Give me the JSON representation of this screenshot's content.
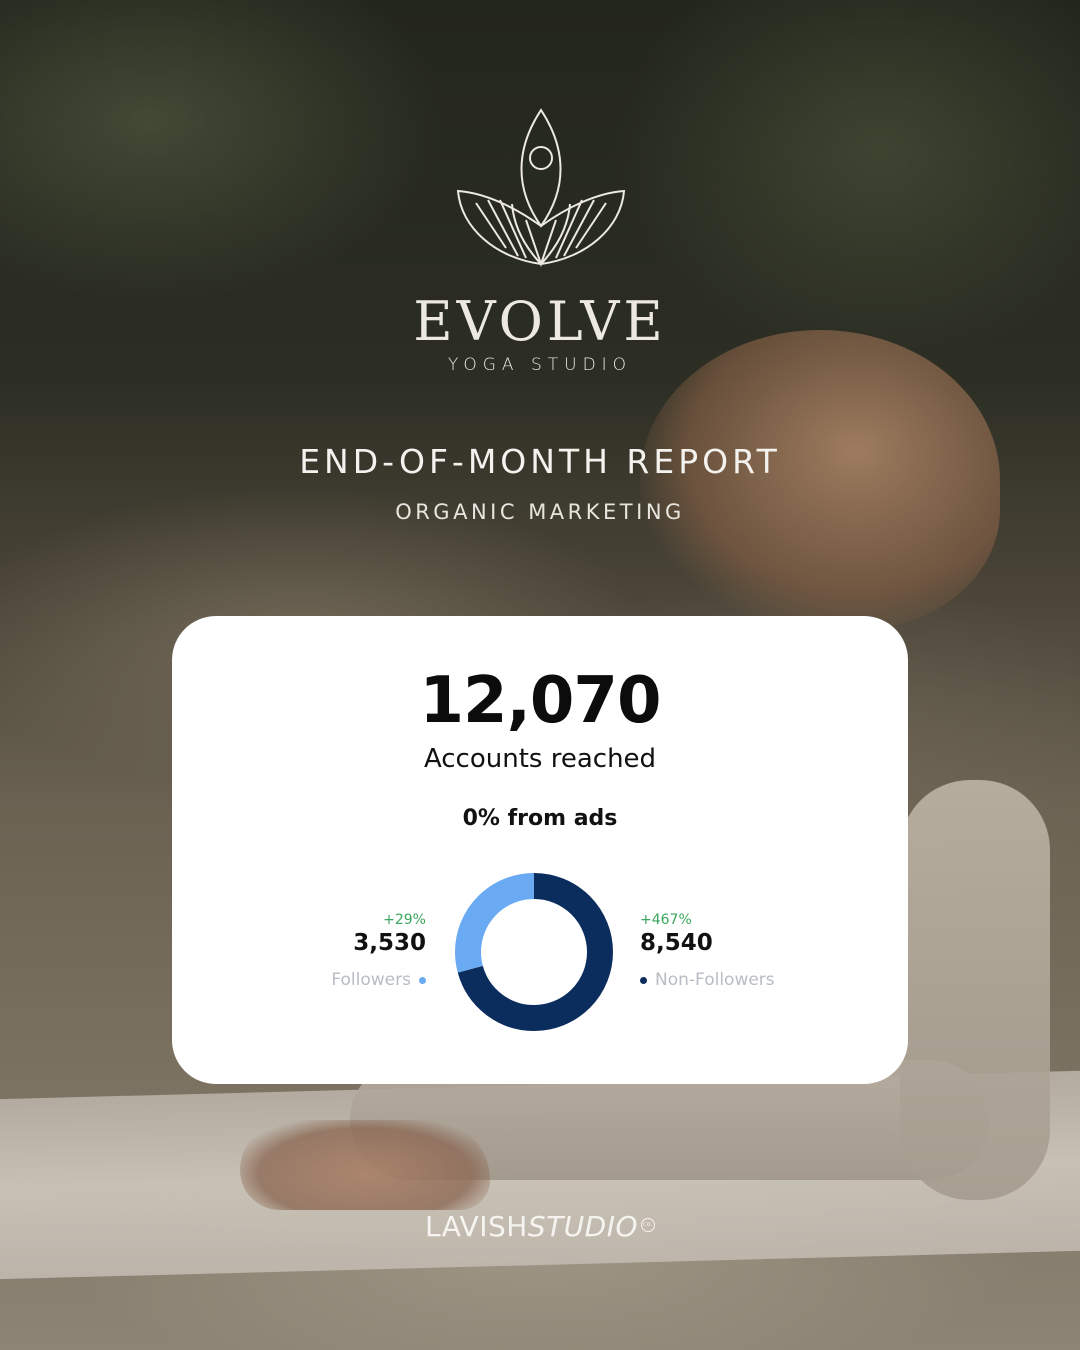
{
  "brand": {
    "name": "EVOLVE",
    "subtitle": "YOGA STUDIO",
    "logo_icon": "lotus-icon"
  },
  "report": {
    "title": "END-OF-MONTH REPORT",
    "subtitle": "ORGANIC MARKETING"
  },
  "card": {
    "accounts_reached_value": "12,070",
    "accounts_reached_label": "Accounts reached",
    "ads_label": "0% from ads",
    "followers": {
      "change": "+29%",
      "value": "3,530",
      "label": "Followers",
      "color": "#6aaaf2"
    },
    "non_followers": {
      "change": "+467%",
      "value": "8,540",
      "label": "Non-Followers",
      "color": "#0b2d5e"
    }
  },
  "chart_data": {
    "type": "pie",
    "categories": [
      "Followers",
      "Non-Followers"
    ],
    "values": [
      3530,
      8540
    ],
    "colors": [
      "#6aaaf2",
      "#0b2d5e"
    ],
    "style": "donut"
  },
  "footer": {
    "brand_regular": "LAVISH",
    "brand_italic": "STUDIO",
    "mark": "co."
  }
}
